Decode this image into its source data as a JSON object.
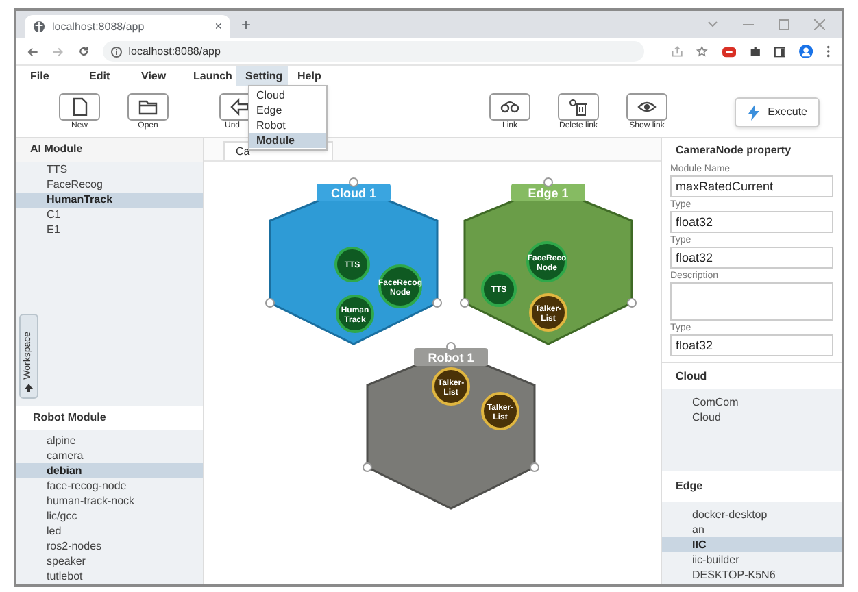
{
  "browser": {
    "tab_title": "localhost:8088/app",
    "tab_close": "×",
    "new_tab": "+",
    "address": "localhost:8088/app"
  },
  "menu": [
    {
      "label": "File",
      "selected": false
    },
    {
      "label": "Edit",
      "selected": false
    },
    {
      "label": "View",
      "selected": false
    },
    {
      "label": "Launch",
      "selected": false
    },
    {
      "label": "Setting",
      "selected": true
    },
    {
      "label": "Help",
      "selected": false
    }
  ],
  "dropdown": [
    {
      "label": "Cloud",
      "selected": false
    },
    {
      "label": "Edge",
      "selected": false
    },
    {
      "label": "Robot",
      "selected": false
    },
    {
      "label": "Module",
      "selected": true
    }
  ],
  "toolbar": [
    {
      "kind": "new",
      "label": "New"
    },
    {
      "kind": "open",
      "label": "Open"
    },
    {
      "kind": "undo",
      "label": "Und"
    },
    {
      "kind": "link",
      "label": "Link"
    },
    {
      "kind": "unlink",
      "label": "Delete link"
    },
    {
      "kind": "show",
      "label": "Show link"
    }
  ],
  "execute_button": "Execute",
  "ai_module": {
    "title": "AI Module",
    "items": [
      {
        "label": "TTS",
        "selected": false
      },
      {
        "label": "FaceRecog",
        "selected": false
      },
      {
        "label": "HumanTrack",
        "selected": true
      },
      {
        "label": "C1",
        "selected": false
      },
      {
        "label": "E1",
        "selected": false
      }
    ]
  },
  "workspace_tab": "Workspace",
  "robot_module": {
    "title": "Robot Module",
    "items": [
      {
        "label": "alpine",
        "selected": false
      },
      {
        "label": "camera",
        "selected": false
      },
      {
        "label": "debian",
        "selected": true
      },
      {
        "label": "face-recog-node",
        "selected": false
      },
      {
        "label": "human-track-nock",
        "selected": false
      },
      {
        "label": "lic/gcc",
        "selected": false
      },
      {
        "label": "led",
        "selected": false
      },
      {
        "label": "ros2-nodes",
        "selected": false
      },
      {
        "label": "speaker",
        "selected": false
      },
      {
        "label": "tutlebot",
        "selected": false
      }
    ]
  },
  "canvas_tab": "Ca",
  "groups": [
    {
      "kind": "cloud",
      "title": "Cloud 1",
      "modules": [
        {
          "label": "TTS",
          "highlighted": false
        },
        {
          "label": "FaceRecog Node",
          "highlighted": false
        },
        {
          "label": "Human Track",
          "highlighted": false
        }
      ]
    },
    {
      "kind": "edge",
      "title": "Edge 1",
      "modules": [
        {
          "label": "FaceReco Node",
          "highlighted": false
        },
        {
          "label": "TTS",
          "highlighted": false
        },
        {
          "label": "Talker-List",
          "highlighted": true
        }
      ]
    },
    {
      "kind": "robot",
      "title": "Robot 1",
      "modules": [
        {
          "label": "Talker-List",
          "highlighted": true
        },
        {
          "label": "Talker-List",
          "highlighted": true
        }
      ]
    }
  ],
  "property": {
    "title": "CameraNode property",
    "fields": [
      {
        "label": "Module Name",
        "value": "maxRatedCurrent",
        "kind": "input"
      },
      {
        "label": "Type",
        "value": "float32",
        "kind": "input"
      },
      {
        "label": "Type",
        "value": "float32",
        "kind": "input"
      },
      {
        "label": "Description",
        "kind": "textarea"
      },
      {
        "label": "Type",
        "value": "float32",
        "kind": "input"
      }
    ]
  },
  "cloud": {
    "title": "Cloud",
    "items": [
      {
        "label": "ComCom",
        "selected": false
      },
      {
        "label": "Cloud",
        "selected": false
      }
    ]
  },
  "edge": {
    "title": "Edge",
    "items": [
      {
        "label": "docker-desktop",
        "selected": false
      },
      {
        "label": "an",
        "selected": false
      },
      {
        "label": "IIC",
        "selected": true
      },
      {
        "label": "iic-builder",
        "selected": false
      },
      {
        "label": "DESKTOP-K5N6",
        "selected": false
      }
    ]
  }
}
